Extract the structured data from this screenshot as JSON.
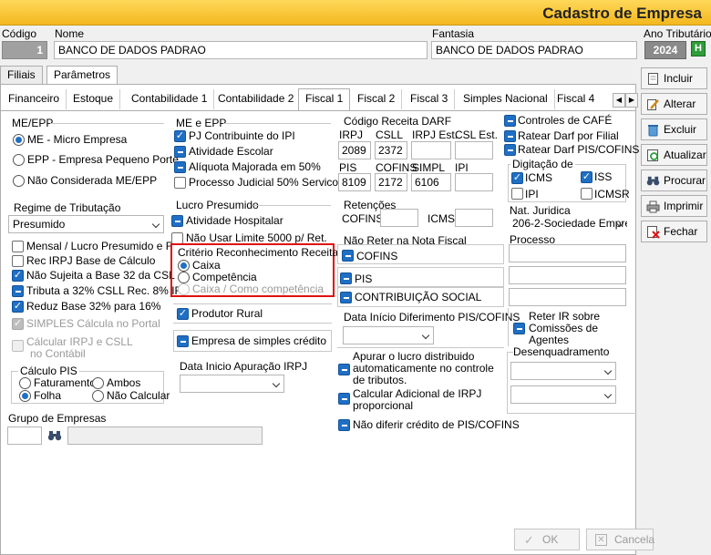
{
  "window": {
    "title": "Cadastro de Empresa"
  },
  "header": {
    "codigo_label": "Código",
    "codigo_value": "1",
    "nome_label": "Nome",
    "nome_value": "BANCO DE DADOS PADRAO",
    "fantasia_label": "Fantasia",
    "fantasia_value": "BANCO DE DADOS PADRAO",
    "ano_label": "Ano Tributário",
    "ano_value": "2024",
    "ano_btn": "H"
  },
  "main_tabs": [
    "Filiais",
    "Parâmetros"
  ],
  "sub_tabs": [
    "Financeiro",
    "Estoque",
    "Contabilidade 1",
    "Contabilidade 2",
    "Fiscal 1",
    "Fiscal 2",
    "Fiscal 3",
    "Simples Nacional",
    "Fiscal 4"
  ],
  "me_epp": {
    "title": "ME/EPP",
    "options": [
      "ME - Micro Empresa",
      "EPP - Empresa Pequeno Porte",
      "Não Considerada ME/EPP"
    ]
  },
  "me_e_epp": {
    "title": "ME e EPP",
    "items": [
      "PJ Contribuinte do IPI",
      "Atividade Escolar",
      "Alíquota Majorada em 50%",
      "Processo Judicial 50% Servicos"
    ]
  },
  "regime": {
    "title": "Regime de Tributação",
    "value": "Presumido",
    "items": [
      "Mensal / Lucro Presumido e F",
      "Rec IRPJ Base de Cálculo",
      "Não Sujeita a Base 32 da CSL",
      "Tributa a 32% CSLL Rec. 8% IR",
      "Reduz Base 32% para 16%",
      "SIMPLES Cálcula  no Portal",
      "Cálcular IRPJ e CSLL",
      "no Contábil"
    ]
  },
  "calculo_pis": {
    "title": "Cálculo PIS",
    "options": [
      "Faturamento",
      "Ambos",
      "Folha",
      "Não Calcular"
    ]
  },
  "grupo": {
    "title": "Grupo de Empresas"
  },
  "lucro_presumido": {
    "title": "Lucro Presumido",
    "items": [
      "Atividade Hospitalar",
      "Não Usar Limite 5000 p/ Ret."
    ],
    "criterio_title": "Critério Reconhecimento  Receita",
    "criterio_options": [
      "Caixa",
      "Competência",
      "Caixa / Como competência"
    ],
    "produtor": "Produtor Rural",
    "simples_credito": "Empresa de simples crédito",
    "data_apuracao": "Data Inicio Apuração IRPJ"
  },
  "darf": {
    "title": "Código Receita DARF",
    "row1_labels": [
      "IRPJ",
      "CSLL",
      "IRPJ Est.",
      "CSL Est."
    ],
    "row1_values": [
      "2089",
      "2372",
      "",
      ""
    ],
    "row2_labels": [
      "PIS",
      "COFINS",
      "SIMPL",
      "IPI"
    ],
    "row2_values": [
      "8109",
      "2172",
      "6106",
      ""
    ]
  },
  "retencoes": {
    "title": "Retenções",
    "cofins": "COFINS",
    "icms": "ICMS"
  },
  "nao_reter": {
    "title": "Não Reter na Nota Fiscal",
    "items": [
      "COFINS",
      "PIS",
      "CONTRIBUIÇÃO SOCIAL"
    ]
  },
  "data_diferimento": "Data Início Diferimento PIS/COFINS",
  "apurar": {
    "items": [
      "Apurar o lucro distribuido automaticamente no controle de tributos.",
      "Calcular Adicional de IRPJ proporcional",
      "Não diferir crédito de  PIS/COFINS"
    ]
  },
  "controles": {
    "items": [
      "Controles de CAFÉ",
      "Ratear Darf por Filial",
      "Ratear Darf PIS/COFINS"
    ]
  },
  "digitacao": {
    "title": "Digitação de",
    "items": [
      "ICMS",
      "ISS",
      "IPI",
      "ICMSR"
    ]
  },
  "nat_juridica": {
    "title": "Nat. Juridica",
    "value": "206-2-Sociedade Empre"
  },
  "processo": {
    "title": "Processo"
  },
  "reter_ir": {
    "label": "Reter IR sobre Comissões de Agentes"
  },
  "desenquadramento": {
    "title": "Desenquadramento"
  },
  "actions": [
    "Incluir",
    "Alterar",
    "Excluir",
    "Atualizar",
    "Procurar",
    "Imprimir",
    "Fechar"
  ],
  "footer": {
    "ok": "OK",
    "cancel": "Cancela"
  }
}
